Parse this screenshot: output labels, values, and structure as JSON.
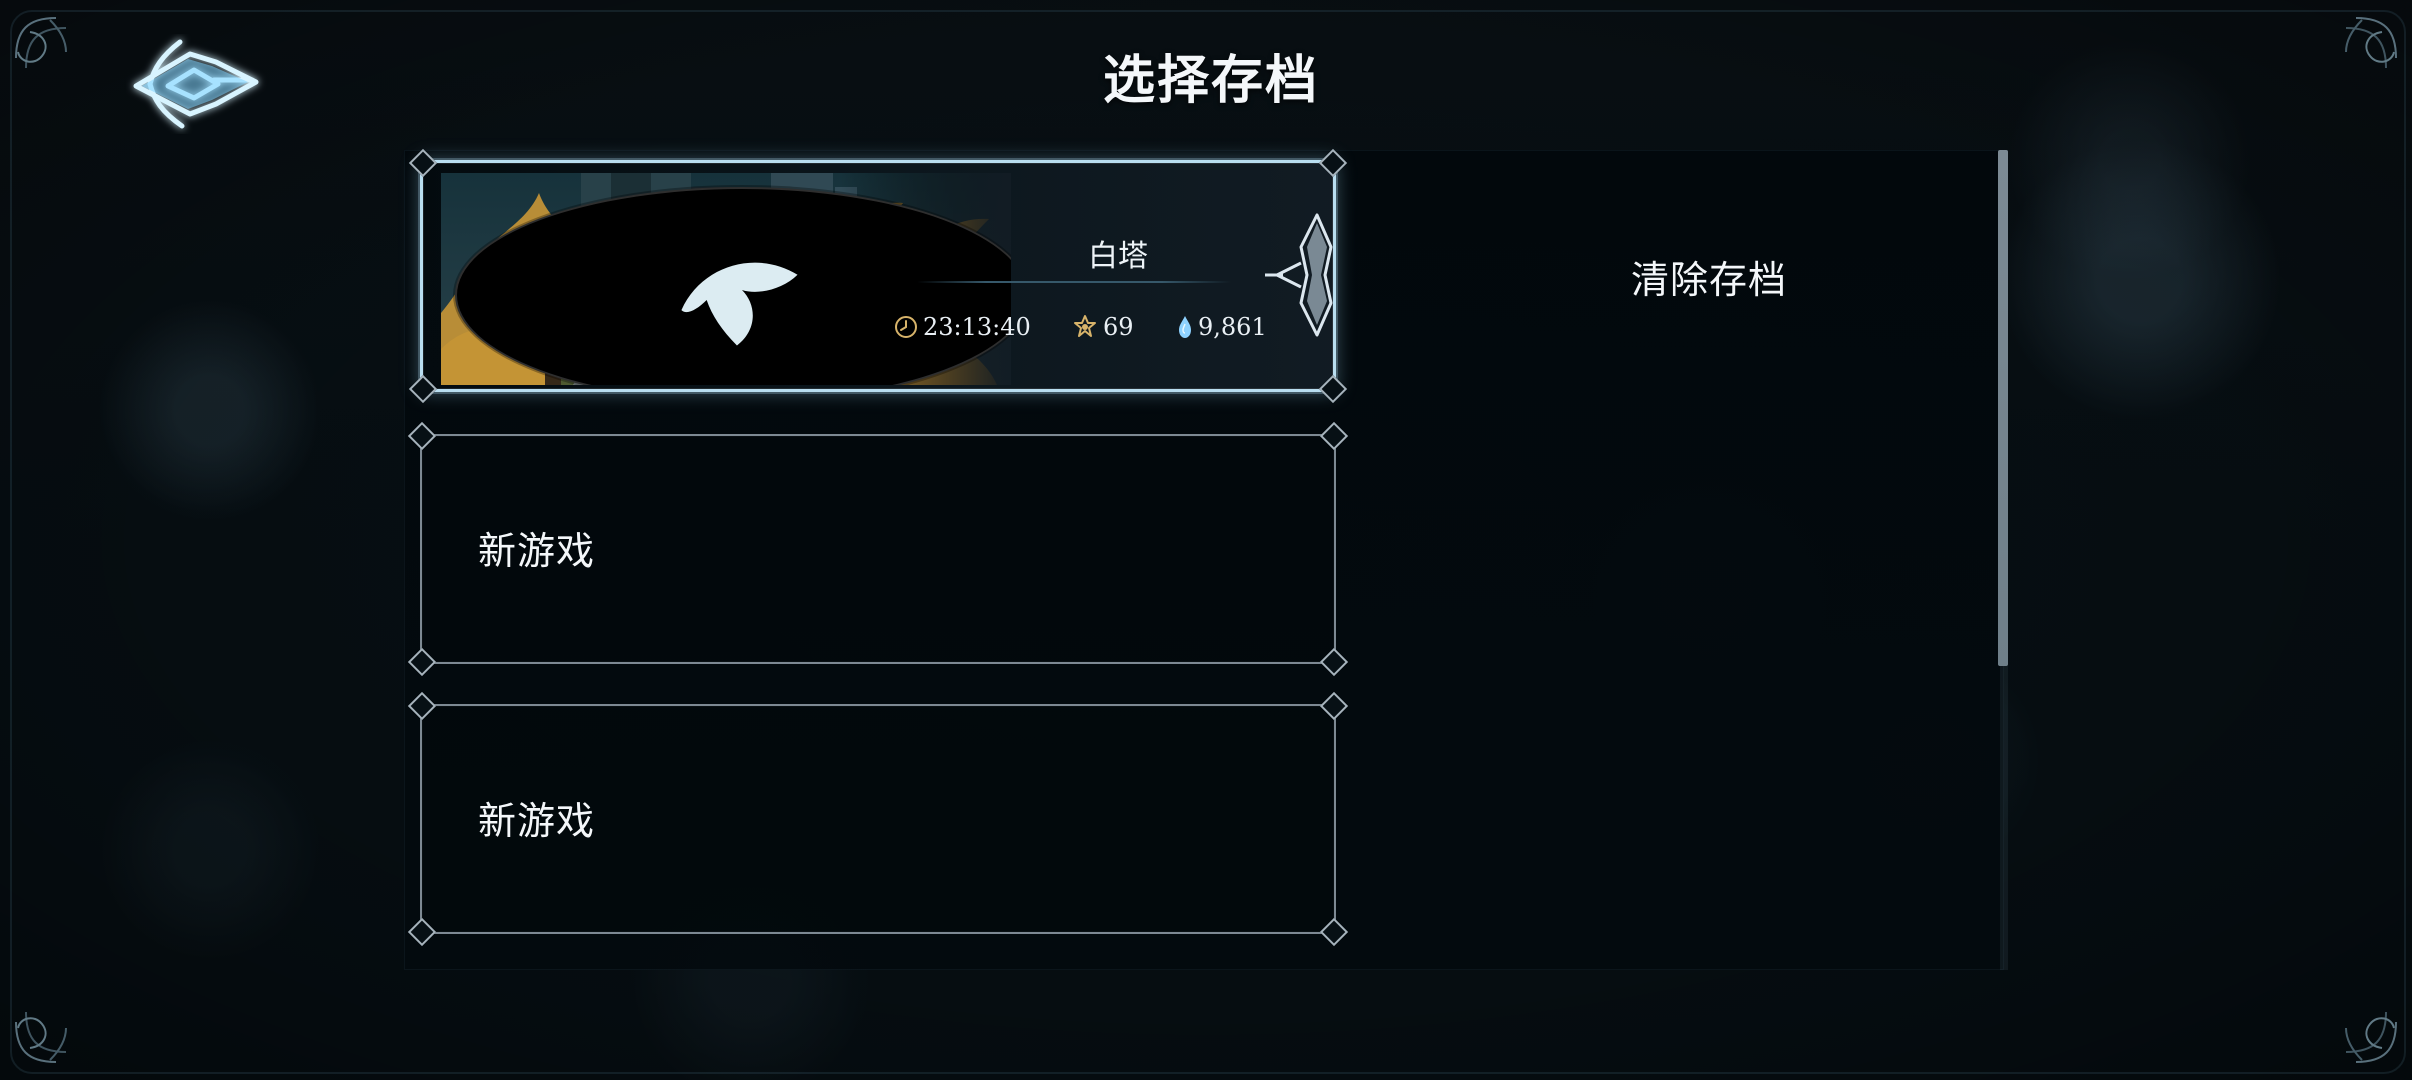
{
  "page": {
    "title": "选择存档"
  },
  "slots": [
    {
      "location": "白塔",
      "play_time": "23:13:40",
      "level": "69",
      "souls": "9,861"
    },
    {
      "label": "新游戏"
    },
    {
      "label": "新游戏"
    }
  ],
  "actions": {
    "clear_save": "清除存档"
  },
  "icons": {
    "back": "back-arrow-icon",
    "save": "save-emblem-icon",
    "time": "clock-icon",
    "level": "level-icon",
    "souls": "soul-drop-icon",
    "crest": "crest-icon"
  }
}
